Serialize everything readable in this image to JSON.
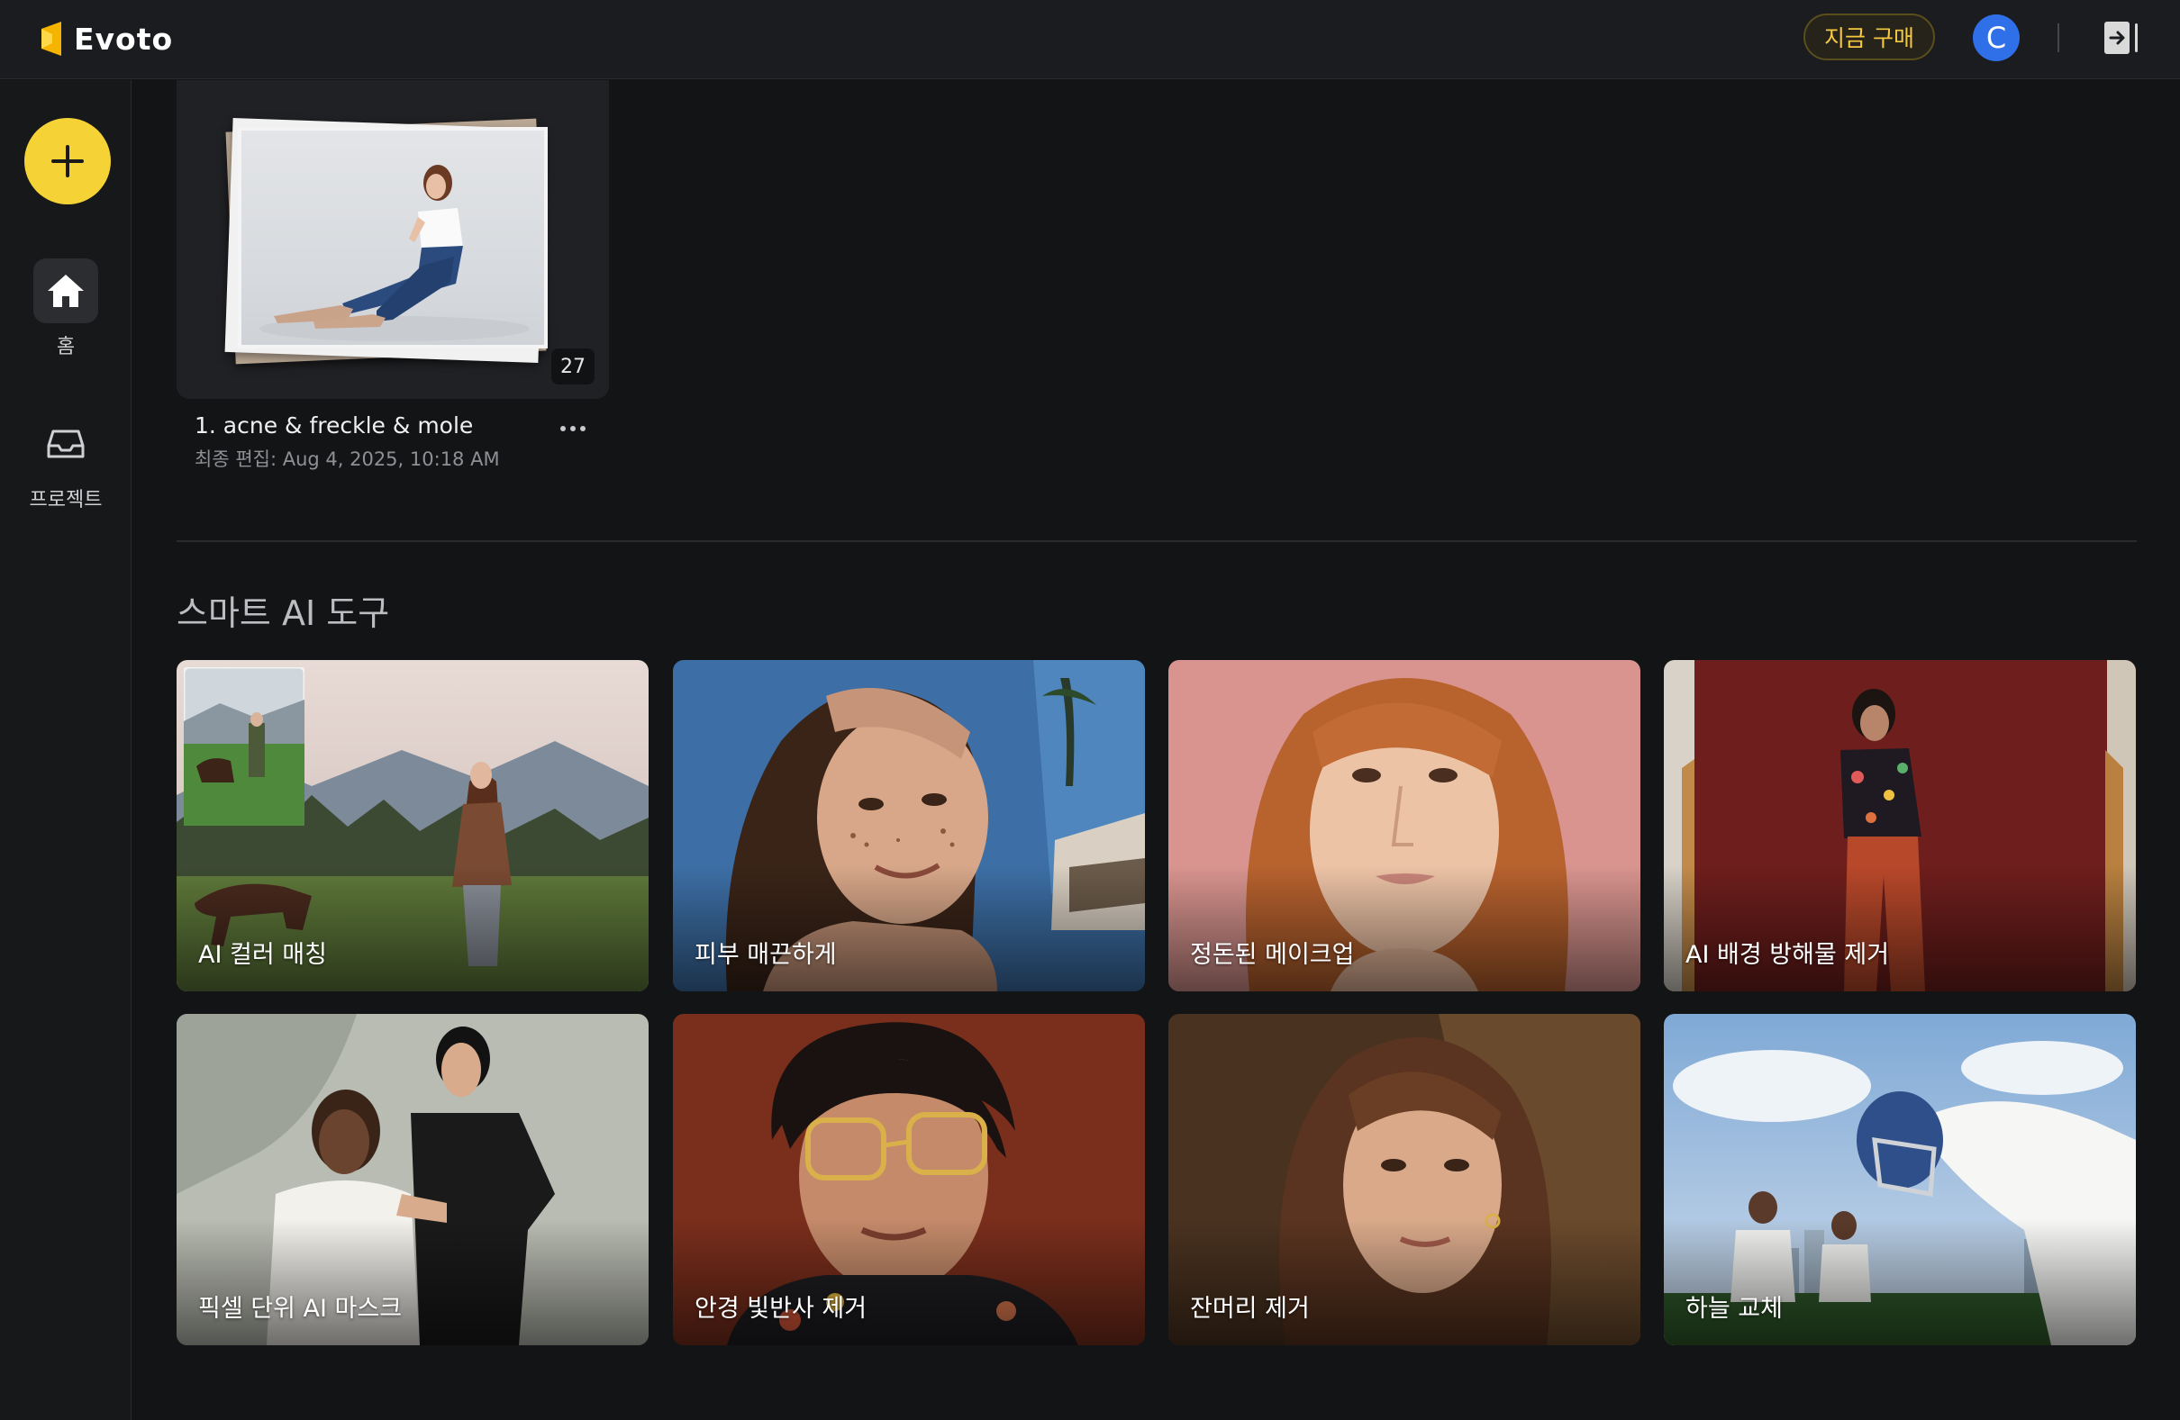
{
  "app": {
    "logo_text": "Evoto",
    "buy_button": "지금 구매",
    "avatar_initial": "C",
    "brand_color": "#f5d235",
    "avatar_color": "#2f6fe8"
  },
  "sidebar": {
    "items": [
      {
        "label": "홈",
        "icon": "home-icon"
      },
      {
        "label": "프로젝트",
        "icon": "inbox-icon"
      }
    ]
  },
  "project": {
    "count": "27",
    "name": "1. acne & freckle & mole",
    "meta": "최종 편집: Aug 4, 2025, 10:18 AM"
  },
  "tools": {
    "title": "스마트 AI 도구",
    "items": [
      {
        "label": "AI 컬러 매칭"
      },
      {
        "label": "피부 매끈하게"
      },
      {
        "label": "정돈된 메이크업"
      },
      {
        "label": "AI 배경 방해물 제거"
      },
      {
        "label": "픽셀 단위 AI 마스크"
      },
      {
        "label": "안경 빛반사 제거"
      },
      {
        "label": "잔머리 제거"
      },
      {
        "label": "하늘 교체"
      }
    ]
  }
}
